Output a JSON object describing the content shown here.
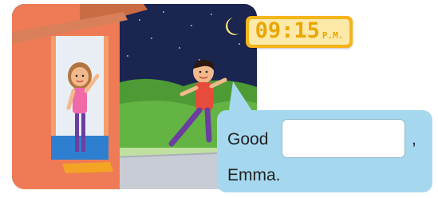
{
  "clock": {
    "time": "09:15",
    "period": "P.M."
  },
  "dialogue": {
    "word_before": "Good",
    "answer_value": "",
    "comma": ",",
    "name": "Emma."
  },
  "colors": {
    "sky": "#1f2f59",
    "hills": "#5aa83a",
    "house": "#ef7f58",
    "bubble": "#a5d8ef",
    "clock_frame": "#f4b41a"
  }
}
